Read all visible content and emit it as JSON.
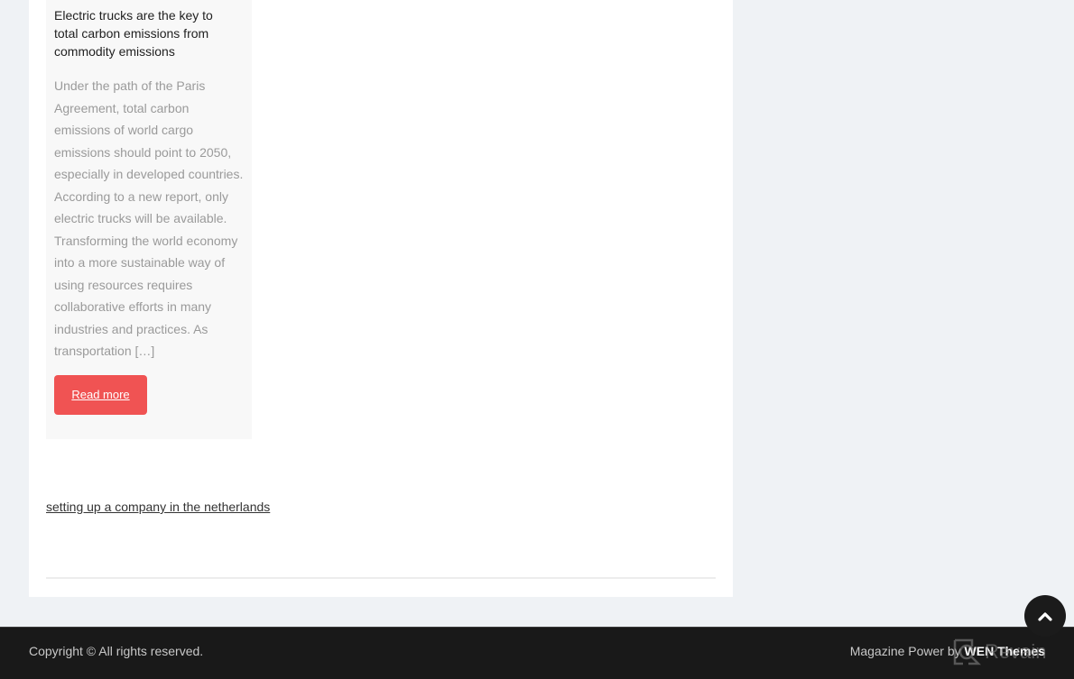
{
  "post": {
    "title": "Electric trucks are the key to total carbon emissions from commodity emissions",
    "excerpt": "Under the path of the Paris Agreement, total carbon emissions of world cargo emissions should point to 2050, especially in developed countries. According to a new report, only electric trucks will be available. Transforming the world economy into a more sustainable way of using resources requires collaborative efforts in many industries and practices. As transportation […]",
    "read_more_label": "Read more"
  },
  "related_link": "setting up a company in the netherlands",
  "footer": {
    "copyright": "Copyright © All rights reserved.",
    "powered_prefix": "Magazine Power by ",
    "powered_brand": "WEN Themes"
  },
  "scroll_top_icon": "chevron-up-icon",
  "watermark": {
    "icon": "revain-logo-icon",
    "text": "Revain"
  },
  "colors": {
    "accent": "#f05353",
    "page_bg": "#eff2f5",
    "footer_bg": "#191919"
  }
}
